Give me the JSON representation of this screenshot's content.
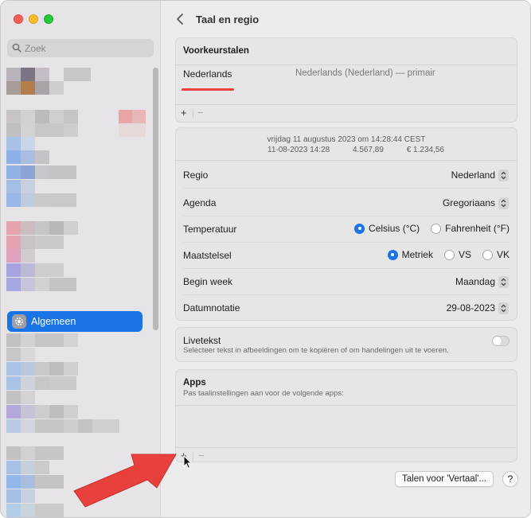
{
  "sidebar": {
    "search_placeholder": "Zoek",
    "active_item_label": "Algemeen",
    "active_item_icon": "gear-icon"
  },
  "header": {
    "title": "Taal en regio",
    "back_icon": "chevron-left-icon"
  },
  "preferred_languages": {
    "heading": "Voorkeurstalen",
    "items": [
      {
        "name": "Nederlands",
        "description": "Nederlands (Nederland) — primair"
      }
    ],
    "add_label": "+",
    "remove_label": "−"
  },
  "formats": {
    "preview_line1": "vrijdag 11 augustus 2023 om 14:28:44 CEST",
    "preview_date_time": "11-08-2023 14:28",
    "preview_number": "4.567,89",
    "preview_currency": "€ 1.234,56",
    "rows": {
      "region": {
        "label": "Regio",
        "value": "Nederland"
      },
      "calendar": {
        "label": "Agenda",
        "value": "Gregoriaans"
      },
      "temperature": {
        "label": "Temperatuur",
        "option1": "Celsius (°C)",
        "option2": "Fahrenheit (°F)",
        "selected": "Celsius (°C)"
      },
      "measurement": {
        "label": "Maatstelsel",
        "option1": "Metriek",
        "option2": "VS",
        "option3": "VK",
        "selected": "Metriek"
      },
      "first_day": {
        "label": "Begin week",
        "value": "Maandag"
      },
      "date_format": {
        "label": "Datumnotatie",
        "value": "29-08-2023"
      }
    }
  },
  "live_text": {
    "title": "Livetekst",
    "description": "Selecteer tekst in afbeeldingen om te kopiëren of om handelingen uit te voeren.",
    "enabled": false
  },
  "apps": {
    "heading": "Apps",
    "description": "Pas taalinstellingen aan voor de volgende apps:",
    "add_label": "+",
    "remove_label": "−"
  },
  "footer": {
    "translate_button": "Talen voor 'Vertaal'...",
    "help_button": "?"
  },
  "colors": {
    "accent": "#1a74e6",
    "annotation_red": "#e8403c"
  }
}
